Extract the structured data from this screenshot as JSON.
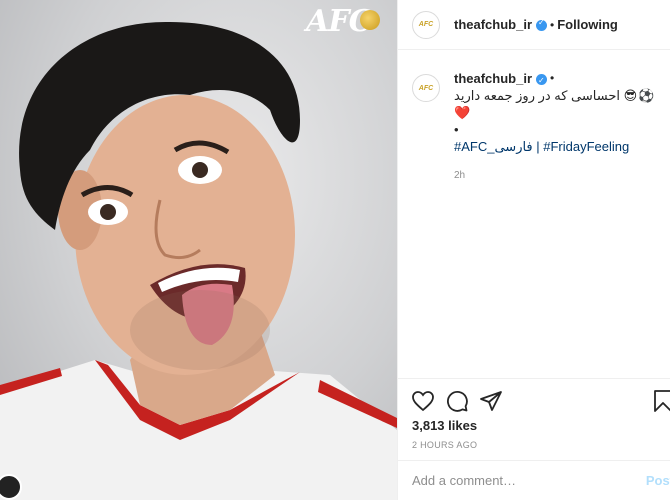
{
  "photo": {
    "logo_text": "AFC",
    "alt": "Player portrait"
  },
  "post": {
    "username": "theafchub_ir",
    "separator": "•",
    "follow_status": "Following",
    "caption": {
      "username": "theafchub_ir",
      "text": "احساسی که در روز جمعه دارید",
      "emojis": "😎⚽❤️",
      "bullet": "•",
      "hashtag_1": "#AFC_فارسی",
      "hashtag_sep": " | ",
      "hashtag_2": "#FridayFeeling",
      "time": "2h"
    },
    "likes": "3,813 likes",
    "time_ago": "2 HOURS AGO",
    "comment_placeholder": "Add a comment…",
    "post_label": "Post",
    "avatar_label": "AFC"
  },
  "icons": {
    "like": "heart-icon",
    "comment": "comment-icon",
    "share": "share-icon",
    "save": "bookmark-icon"
  },
  "colors": {
    "verified": "#3897f0",
    "hashtag": "#00376b",
    "post_disabled": "#b2dffc"
  }
}
